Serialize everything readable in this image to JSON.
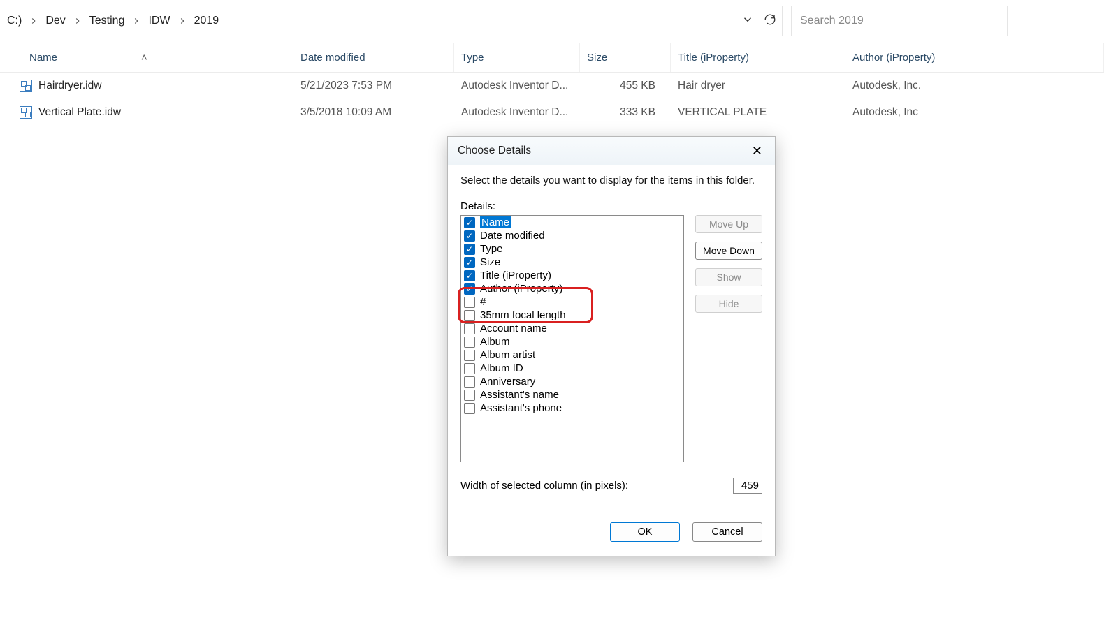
{
  "address": {
    "crumbs": [
      "C:)",
      "Dev",
      "Testing",
      "IDW",
      "2019"
    ]
  },
  "search": {
    "placeholder": "Search 2019"
  },
  "columns": {
    "name": "Name",
    "date": "Date modified",
    "type": "Type",
    "size": "Size",
    "title": "Title (iProperty)",
    "author": "Author (iProperty)"
  },
  "files": [
    {
      "name": "Hairdryer.idw",
      "date": "5/21/2023 7:53 PM",
      "type": "Autodesk Inventor D...",
      "size": "455 KB",
      "title": "Hair dryer",
      "author": "Autodesk, Inc."
    },
    {
      "name": "Vertical Plate.idw",
      "date": "3/5/2018 10:09 AM",
      "type": "Autodesk Inventor D...",
      "size": "333 KB",
      "title": "VERTICAL PLATE",
      "author": "Autodesk, Inc"
    }
  ],
  "dialog": {
    "title": "Choose Details",
    "instruction": "Select the details you want to display for the items in this folder.",
    "details_label": "Details:",
    "items": [
      {
        "label": "Name",
        "checked": true,
        "selected": true
      },
      {
        "label": "Date modified",
        "checked": true
      },
      {
        "label": "Type",
        "checked": true
      },
      {
        "label": "Size",
        "checked": true
      },
      {
        "label": "Title (iProperty)",
        "checked": true
      },
      {
        "label": "Author (iProperty)",
        "checked": true
      },
      {
        "label": "#",
        "checked": false
      },
      {
        "label": "35mm focal length",
        "checked": false
      },
      {
        "label": "Account name",
        "checked": false
      },
      {
        "label": "Album",
        "checked": false
      },
      {
        "label": "Album artist",
        "checked": false
      },
      {
        "label": "Album ID",
        "checked": false
      },
      {
        "label": "Anniversary",
        "checked": false
      },
      {
        "label": "Assistant's name",
        "checked": false
      },
      {
        "label": "Assistant's phone",
        "checked": false
      }
    ],
    "buttons": {
      "move_up": "Move Up",
      "move_down": "Move Down",
      "show": "Show",
      "hide": "Hide",
      "ok": "OK",
      "cancel": "Cancel"
    },
    "width_label": "Width of selected column (in pixels):",
    "width_value": "459"
  }
}
